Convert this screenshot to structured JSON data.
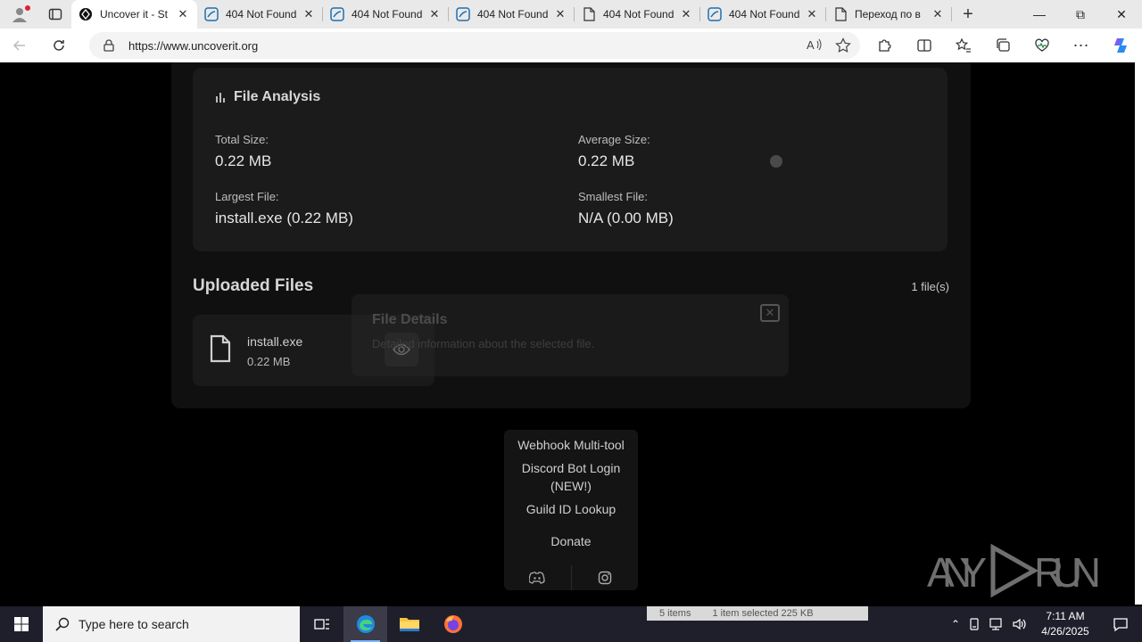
{
  "browser": {
    "tabs": [
      {
        "title": "Uncover it - St",
        "favicon": "uncoverit-logo-icon",
        "active": true
      },
      {
        "title": "404 Not Found",
        "favicon": "discord-like-icon",
        "active": false
      },
      {
        "title": "404 Not Found",
        "favicon": "discord-like-icon",
        "active": false
      },
      {
        "title": "404 Not Found",
        "favicon": "discord-like-icon",
        "active": false
      },
      {
        "title": "404 Not Found",
        "favicon": "page-icon",
        "active": false
      },
      {
        "title": "404 Not Found",
        "favicon": "discord-like-icon",
        "active": false
      },
      {
        "title": "Переход по в",
        "favicon": "page-icon",
        "active": false
      }
    ],
    "url": "https://www.uncoverit.org"
  },
  "analysis": {
    "title": "File Analysis",
    "total_size_label": "Total Size:",
    "total_size_value": "0.22 MB",
    "average_size_label": "Average Size:",
    "average_size_value": "0.22 MB",
    "largest_file_label": "Largest File:",
    "largest_file_value": "install.exe (0.22 MB)",
    "smallest_file_label": "Smallest File:",
    "smallest_file_value": "N/A (0.00 MB)"
  },
  "uploaded": {
    "title": "Uploaded Files",
    "count": "1 file(s)",
    "files": [
      {
        "name": "install.exe",
        "size": "0.22 MB"
      }
    ]
  },
  "modal": {
    "title": "File Details",
    "description": "Detailed information about the selected file."
  },
  "menu": {
    "items": [
      "Webhook Multi-tool",
      "Discord Bot Login",
      "(NEW!)",
      "Guild ID Lookup",
      "Donate"
    ]
  },
  "watermark": {
    "text": "ANY RUN"
  },
  "taskbar": {
    "search_placeholder": "Type here to search",
    "explorer_status": [
      "5 items",
      "1 item selected  225 KB"
    ],
    "time": "7:11 AM",
    "date": "4/26/2025"
  }
}
